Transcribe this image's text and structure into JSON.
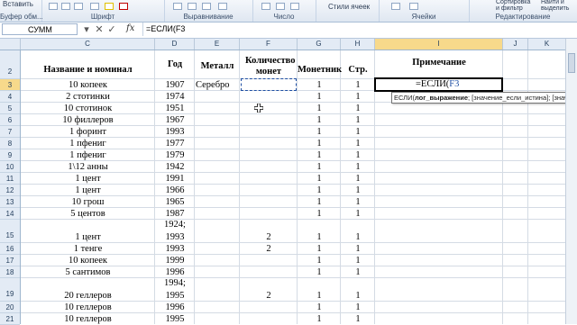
{
  "ribbon": {
    "paste": "Вставить",
    "clipboard_group": "Буфер обм...",
    "font_group": "Шрифт",
    "alignment_group": "Выравнивание",
    "number_group": "Число",
    "styles_label": "Стили ячеек",
    "cells_group": "Ячейки",
    "sort_filter": "Сортировка и фильтр",
    "find_select": "Найти и выделить",
    "editing_group": "Редактирование"
  },
  "formula_bar": {
    "name_box": "СУММ",
    "cancel": "✕",
    "enter": "✓",
    "fx": "fx",
    "content": "=ЕСЛИ(F3"
  },
  "columns": [
    "C",
    "D",
    "E",
    "F",
    "G",
    "H",
    "I",
    "J",
    "K"
  ],
  "rows": [
    "2",
    "3",
    "4",
    "5",
    "6",
    "7",
    "8",
    "9",
    "10",
    "11",
    "12",
    "13",
    "14",
    "15",
    "16",
    "17",
    "18",
    "19",
    "20",
    "21"
  ],
  "headers": {
    "name": "Название и номинал",
    "year": "Год",
    "metal": "Металл",
    "qty": "Количество монет",
    "mint": "Монетник",
    "page": "Стр.",
    "note": "Примечание"
  },
  "data_rows": [
    {
      "name": "10 копеек",
      "year": "1907",
      "metal": "Серебро",
      "qty": "",
      "mint": "1",
      "page": "1"
    },
    {
      "name": "2 стотинки",
      "year": "1974",
      "metal": "",
      "qty": "",
      "mint": "1",
      "page": "1"
    },
    {
      "name": "10 стотинок",
      "year": "1951",
      "metal": "",
      "qty": "",
      "mint": "1",
      "page": "1"
    },
    {
      "name": "10 филлеров",
      "year": "1967",
      "metal": "",
      "qty": "",
      "mint": "1",
      "page": "1"
    },
    {
      "name": "1 форинт",
      "year": "1993",
      "metal": "",
      "qty": "",
      "mint": "1",
      "page": "1"
    },
    {
      "name": "1 пфениг",
      "year": "1977",
      "metal": "",
      "qty": "",
      "mint": "1",
      "page": "1"
    },
    {
      "name": "1 пфениг",
      "year": "1979",
      "metal": "",
      "qty": "",
      "mint": "1",
      "page": "1"
    },
    {
      "name": "1\\12 анны",
      "year": "1942",
      "metal": "",
      "qty": "",
      "mint": "1",
      "page": "1"
    },
    {
      "name": "1 цент",
      "year": "1991",
      "metal": "",
      "qty": "",
      "mint": "1",
      "page": "1"
    },
    {
      "name": "1 цент",
      "year": "1966",
      "metal": "",
      "qty": "",
      "mint": "1",
      "page": "1"
    },
    {
      "name": "10 грош",
      "year": "1965",
      "metal": "",
      "qty": "",
      "mint": "1",
      "page": "1"
    },
    {
      "name": "5 центов",
      "year": "1987",
      "metal": "",
      "qty": "",
      "mint": "1",
      "page": "1"
    },
    {
      "name": "1 цент",
      "year": "1924;",
      "year2": "1993",
      "metal": "",
      "qty": "2",
      "mint": "1",
      "page": "1"
    },
    {
      "name": "1 тенге",
      "year": "1993",
      "metal": "",
      "qty": "2",
      "mint": "1",
      "page": "1"
    },
    {
      "name": "10 копеек",
      "year": "1999",
      "metal": "",
      "qty": "",
      "mint": "1",
      "page": "1"
    },
    {
      "name": "5 сантимов",
      "year": "1996",
      "metal": "",
      "qty": "",
      "mint": "1",
      "page": "1"
    },
    {
      "name": "20 геллеров",
      "year": "1994;",
      "year2": "1995",
      "metal": "",
      "qty": "2",
      "mint": "1",
      "page": "1"
    },
    {
      "name": "10 геллеров",
      "year": "1996",
      "metal": "",
      "qty": "",
      "mint": "1",
      "page": "1"
    },
    {
      "name": "10 геллеров",
      "year": "1995",
      "metal": "",
      "qty": "",
      "mint": "1",
      "page": "1"
    }
  ],
  "active_cell": {
    "ref": "I3",
    "value": "=ЕСЛИ(",
    "ref_part": "F3"
  },
  "tooltip": {
    "fn": "ЕСЛИ(",
    "arg1": "лог_выражение",
    "rest": "; [значение_если_истина]; [значени"
  }
}
